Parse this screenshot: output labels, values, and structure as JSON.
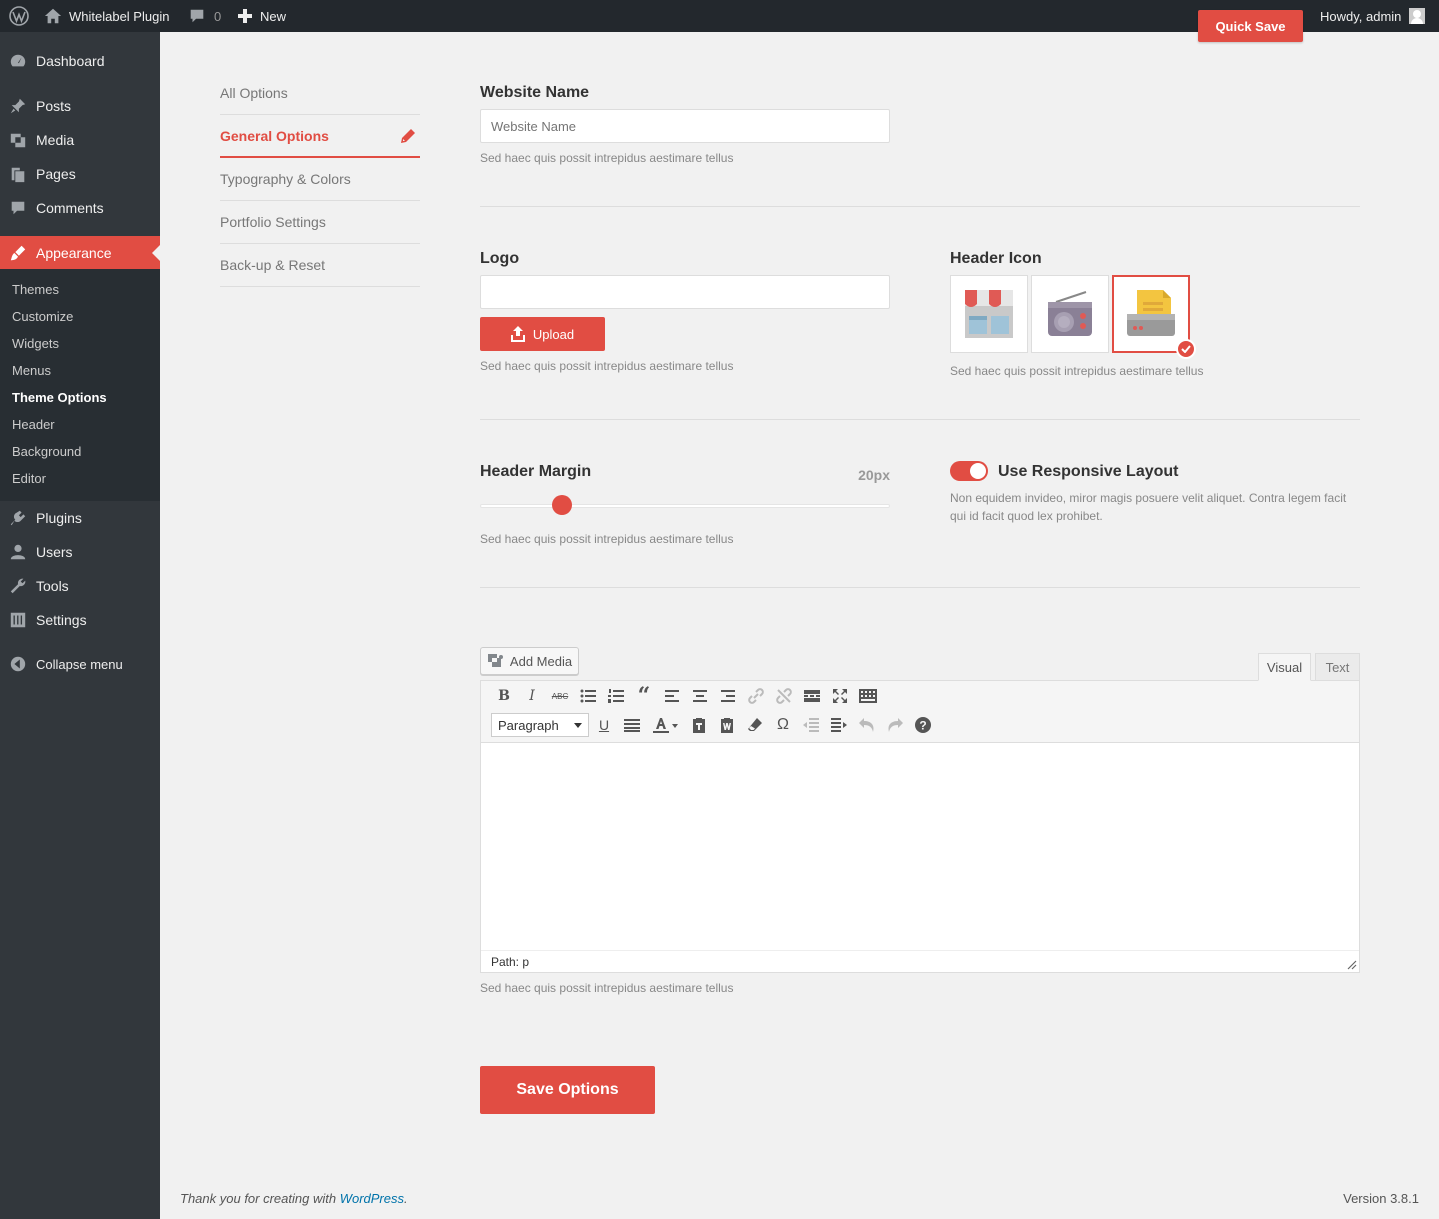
{
  "adminbar": {
    "site_name": "Whitelabel Plugin",
    "comments_count": "0",
    "new_label": "New",
    "quick_save_label": "Quick Save",
    "greeting": "Howdy, admin"
  },
  "sidebar": {
    "items": [
      {
        "label": "Dashboard",
        "icon": "dashboard-icon"
      },
      {
        "label": "Posts",
        "icon": "pin-icon"
      },
      {
        "label": "Media",
        "icon": "media-icon"
      },
      {
        "label": "Pages",
        "icon": "pages-icon"
      },
      {
        "label": "Comments",
        "icon": "comment-icon"
      },
      {
        "label": "Appearance",
        "icon": "brush-icon"
      },
      {
        "label": "Plugins",
        "icon": "plugin-icon"
      },
      {
        "label": "Users",
        "icon": "users-icon"
      },
      {
        "label": "Tools",
        "icon": "wrench-icon"
      },
      {
        "label": "Settings",
        "icon": "settings-icon"
      }
    ],
    "submenu": [
      "Themes",
      "Customize",
      "Widgets",
      "Menus",
      "Theme Options",
      "Header",
      "Background",
      "Editor"
    ],
    "collapse_label": "Collapse menu"
  },
  "options_nav": {
    "items": [
      "All Options",
      "General Options",
      "Typography & Colors",
      "Portfolio Settings",
      "Back-up & Reset"
    ],
    "active_index": 1
  },
  "fields": {
    "website_name": {
      "label": "Website Name",
      "placeholder": "Website Name",
      "desc": "Sed haec quis possit intrepidus aestimare tellus"
    },
    "logo": {
      "label": "Logo",
      "upload_label": "Upload",
      "desc": "Sed haec quis possit intrepidus aestimare tellus"
    },
    "header_icon": {
      "label": "Header Icon",
      "options": [
        "shop-icon",
        "radio-icon",
        "printer-icon"
      ],
      "selected_index": 2,
      "desc": "Sed haec quis possit intrepidus aestimare tellus"
    },
    "header_margin": {
      "label": "Header Margin",
      "value_label": "20px",
      "value_fraction": 0.2,
      "desc": "Sed haec quis possit intrepidus aestimare tellus"
    },
    "responsive": {
      "label": "Use Responsive Layout",
      "enabled": true,
      "desc_line1": "Non equidem invideo, miror magis posuere velit aliquet. Contra legem facit",
      "desc_line2": "qui id facit quod lex prohibet."
    },
    "editor": {
      "add_media_label": "Add Media",
      "tab_visual": "Visual",
      "tab_text": "Text",
      "format_value": "Paragraph",
      "path": "Path: p",
      "desc": "Sed haec quis possit intrepidus aestimare tellus"
    }
  },
  "save_label": "Save Options",
  "footer": {
    "thanks": "Thank you for creating with ",
    "link": "WordPress",
    "period": ".",
    "version": "Version 3.8.1"
  },
  "colors": {
    "accent": "#e14d43",
    "sidebar": "#32373c",
    "adminbar": "#23282d"
  }
}
